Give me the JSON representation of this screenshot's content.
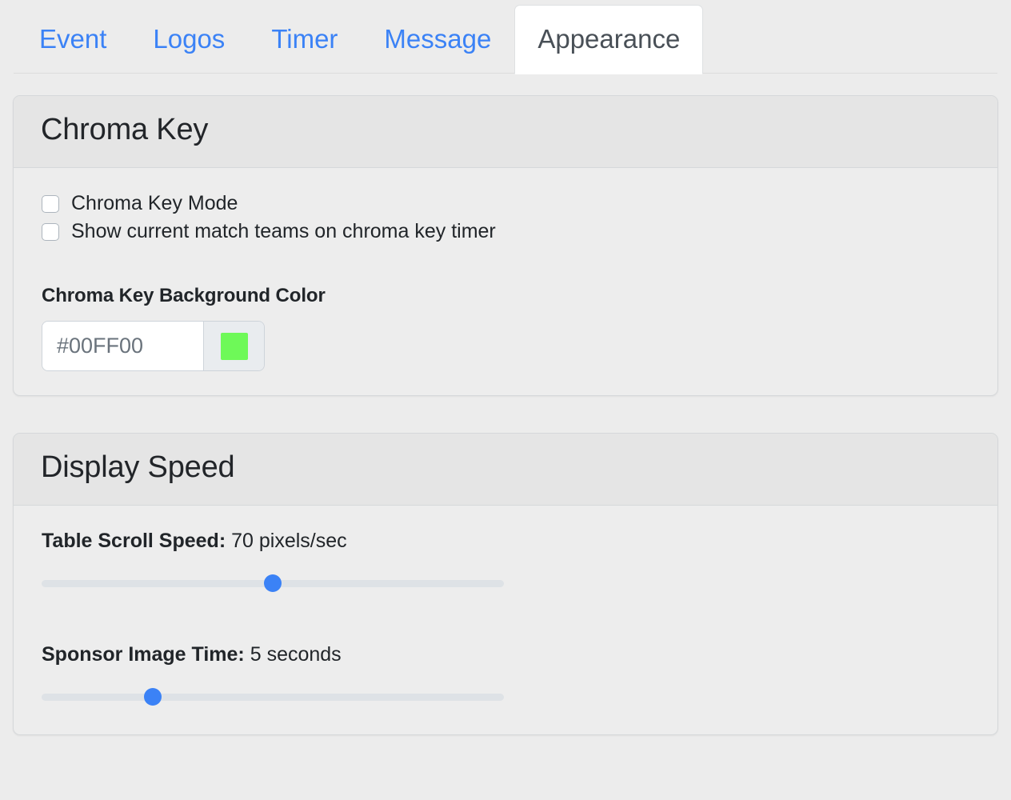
{
  "tabs": [
    {
      "label": "Event",
      "active": false
    },
    {
      "label": "Logos",
      "active": false
    },
    {
      "label": "Timer",
      "active": false
    },
    {
      "label": "Message",
      "active": false
    },
    {
      "label": "Appearance",
      "active": true
    }
  ],
  "chroma_key": {
    "title": "Chroma Key",
    "checkboxes": [
      {
        "label": "Chroma Key Mode",
        "checked": false
      },
      {
        "label": "Show current match teams on chroma key timer",
        "checked": false
      }
    ],
    "color_field": {
      "label": "Chroma Key Background Color",
      "value": "#00FF00",
      "placeholder": "#00FF00",
      "swatch_color": "#6EF958",
      "swatch_icon": "color-swatch-icon"
    }
  },
  "display_speed": {
    "title": "Display Speed",
    "sliders": [
      {
        "name": "table-scroll-speed",
        "label": "Table Scroll Speed:",
        "value_text": "70 pixels/sec",
        "value": 70,
        "percent": 50
      },
      {
        "name": "sponsor-image-time",
        "label": "Sponsor Image Time:",
        "value_text": "5 seconds",
        "value": 5,
        "percent": 24
      }
    ]
  },
  "theme": {
    "accent_blue": "#3b82f6",
    "link_blue": "#3b82f6",
    "page_background": "#ececec",
    "card_background": "#ededed",
    "card_header_background": "#e5e5e5",
    "border": "#d6d8da",
    "text": "#212529",
    "muted_text": "#6a737c"
  }
}
